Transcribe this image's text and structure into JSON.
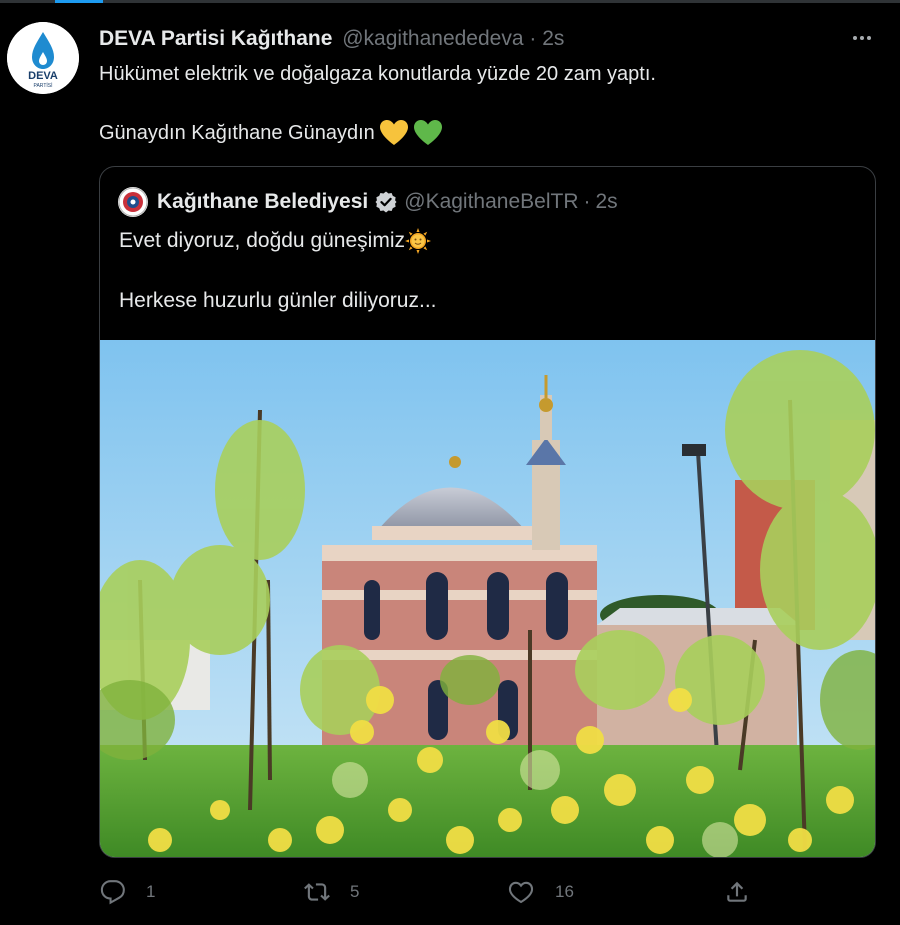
{
  "tweet": {
    "author": {
      "name": "DEVA Partisi Kağıthane",
      "handle": "@kagithanededeva",
      "separator": "·",
      "time": "2s",
      "avatar_text": "DEVA",
      "avatar_subtext": "PARTİSİ"
    },
    "text_line1": "Hükümet elektrik ve doğalgaza konutlarda yüzde 20 zam yaptı.",
    "text_line2": "Günaydın Kağıthane Günaydın",
    "emojis": [
      "yellow-heart",
      "green-heart"
    ],
    "more_icon": "ellipsis-icon"
  },
  "quote": {
    "author": {
      "name": "Kağıthane Belediyesi",
      "verified": true,
      "handle": "@KagithaneBelTR",
      "separator": "·",
      "time": "2s"
    },
    "text_line1": "Evet diyoruz, doğdu güneşimiz",
    "text_line2": "Herkese huzurlu günler diliyoruz...",
    "emoji": "sun-with-face",
    "image_description_icon": "photo"
  },
  "actions": {
    "reply": {
      "icon": "reply-icon",
      "count": "1"
    },
    "retweet": {
      "icon": "retweet-icon",
      "count": "5"
    },
    "like": {
      "icon": "heart-icon",
      "count": "16"
    },
    "share": {
      "icon": "share-icon"
    }
  },
  "colors": {
    "background": "#000000",
    "text": "#e7e9ea",
    "muted": "#71767b",
    "border": "#3a3e42",
    "accent": "#1d9bf0",
    "deva_blue": "#1f8bd0"
  }
}
